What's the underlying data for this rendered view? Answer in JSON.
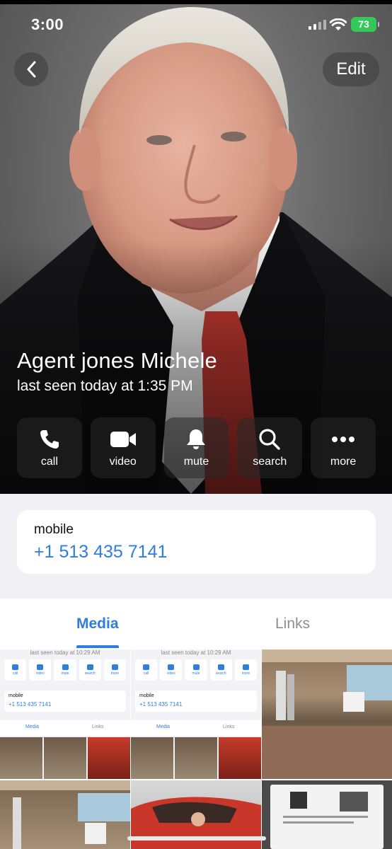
{
  "status_bar": {
    "time": "3:00",
    "battery": "73"
  },
  "nav": {
    "edit_label": "Edit"
  },
  "profile": {
    "name": "Agent jones Michele",
    "last_seen": "last seen today at 1:35 PM"
  },
  "actions": [
    {
      "label": "call",
      "icon": "phone-icon"
    },
    {
      "label": "video",
      "icon": "video-camera-icon"
    },
    {
      "label": "mute",
      "icon": "bell-icon"
    },
    {
      "label": "search",
      "icon": "magnifier-icon"
    },
    {
      "label": "more",
      "icon": "ellipsis-icon"
    }
  ],
  "info_card": {
    "label": "mobile",
    "value": "+1 513 435 7141"
  },
  "tabs": {
    "media": "Media",
    "links": "Links"
  },
  "thumbnails": {
    "mini": {
      "seen": "last seen today at 10:29 AM",
      "mobile": "mobile",
      "phone": "+1 513 435 7141",
      "media": "Media",
      "links": "Links",
      "buttons": [
        "call",
        "video",
        "mute",
        "search",
        "more"
      ]
    }
  },
  "colors": {
    "accent": "#2f7de1",
    "battery": "#34c759",
    "background": "#f1f1f5"
  }
}
